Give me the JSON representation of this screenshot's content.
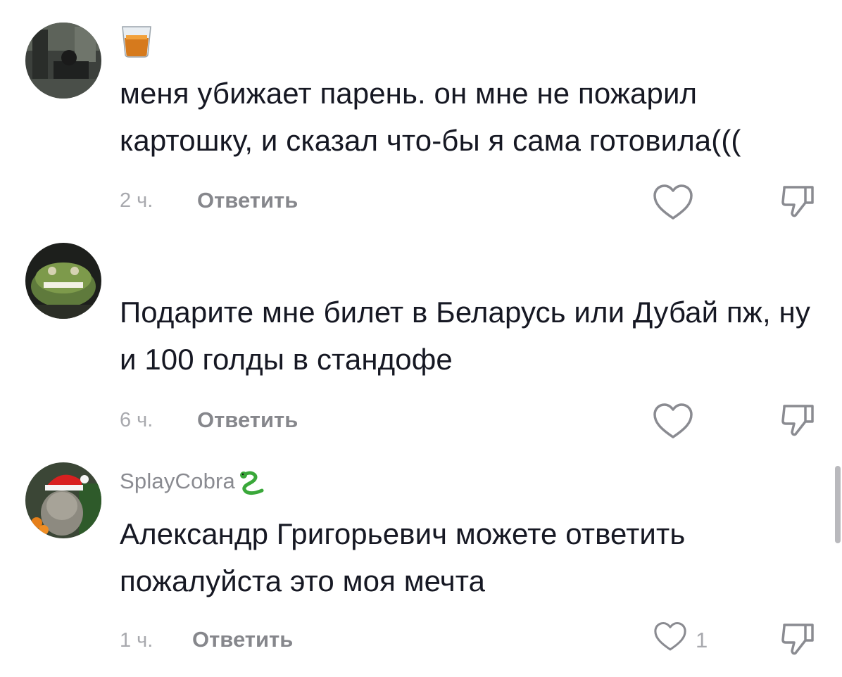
{
  "comments": [
    {
      "username": "",
      "username_emoji": "tumbler-glass",
      "text": "меня убижает парень. он мне не пожарил картошку, и сказал что-бы я сама готовила(((",
      "time": "2 ч.",
      "reply_label": "Ответить",
      "like_count": ""
    },
    {
      "username": "",
      "text": "Подарите мне билет в Беларусь или Дубай пж, ну и 100 голды в стандофе",
      "time": "6 ч.",
      "reply_label": "Ответить",
      "like_count": ""
    },
    {
      "username": "SplayCobra",
      "username_emoji": "snake",
      "text": "Александр Григорьевич можете ответить пожалуйста это моя мечта",
      "time": "1 ч.",
      "reply_label": "Ответить",
      "like_count": "1"
    }
  ],
  "colors": {
    "text": "#161823",
    "secondary": "#8a8b91",
    "time": "#a8a9ae",
    "icon": "#8a8b91"
  }
}
